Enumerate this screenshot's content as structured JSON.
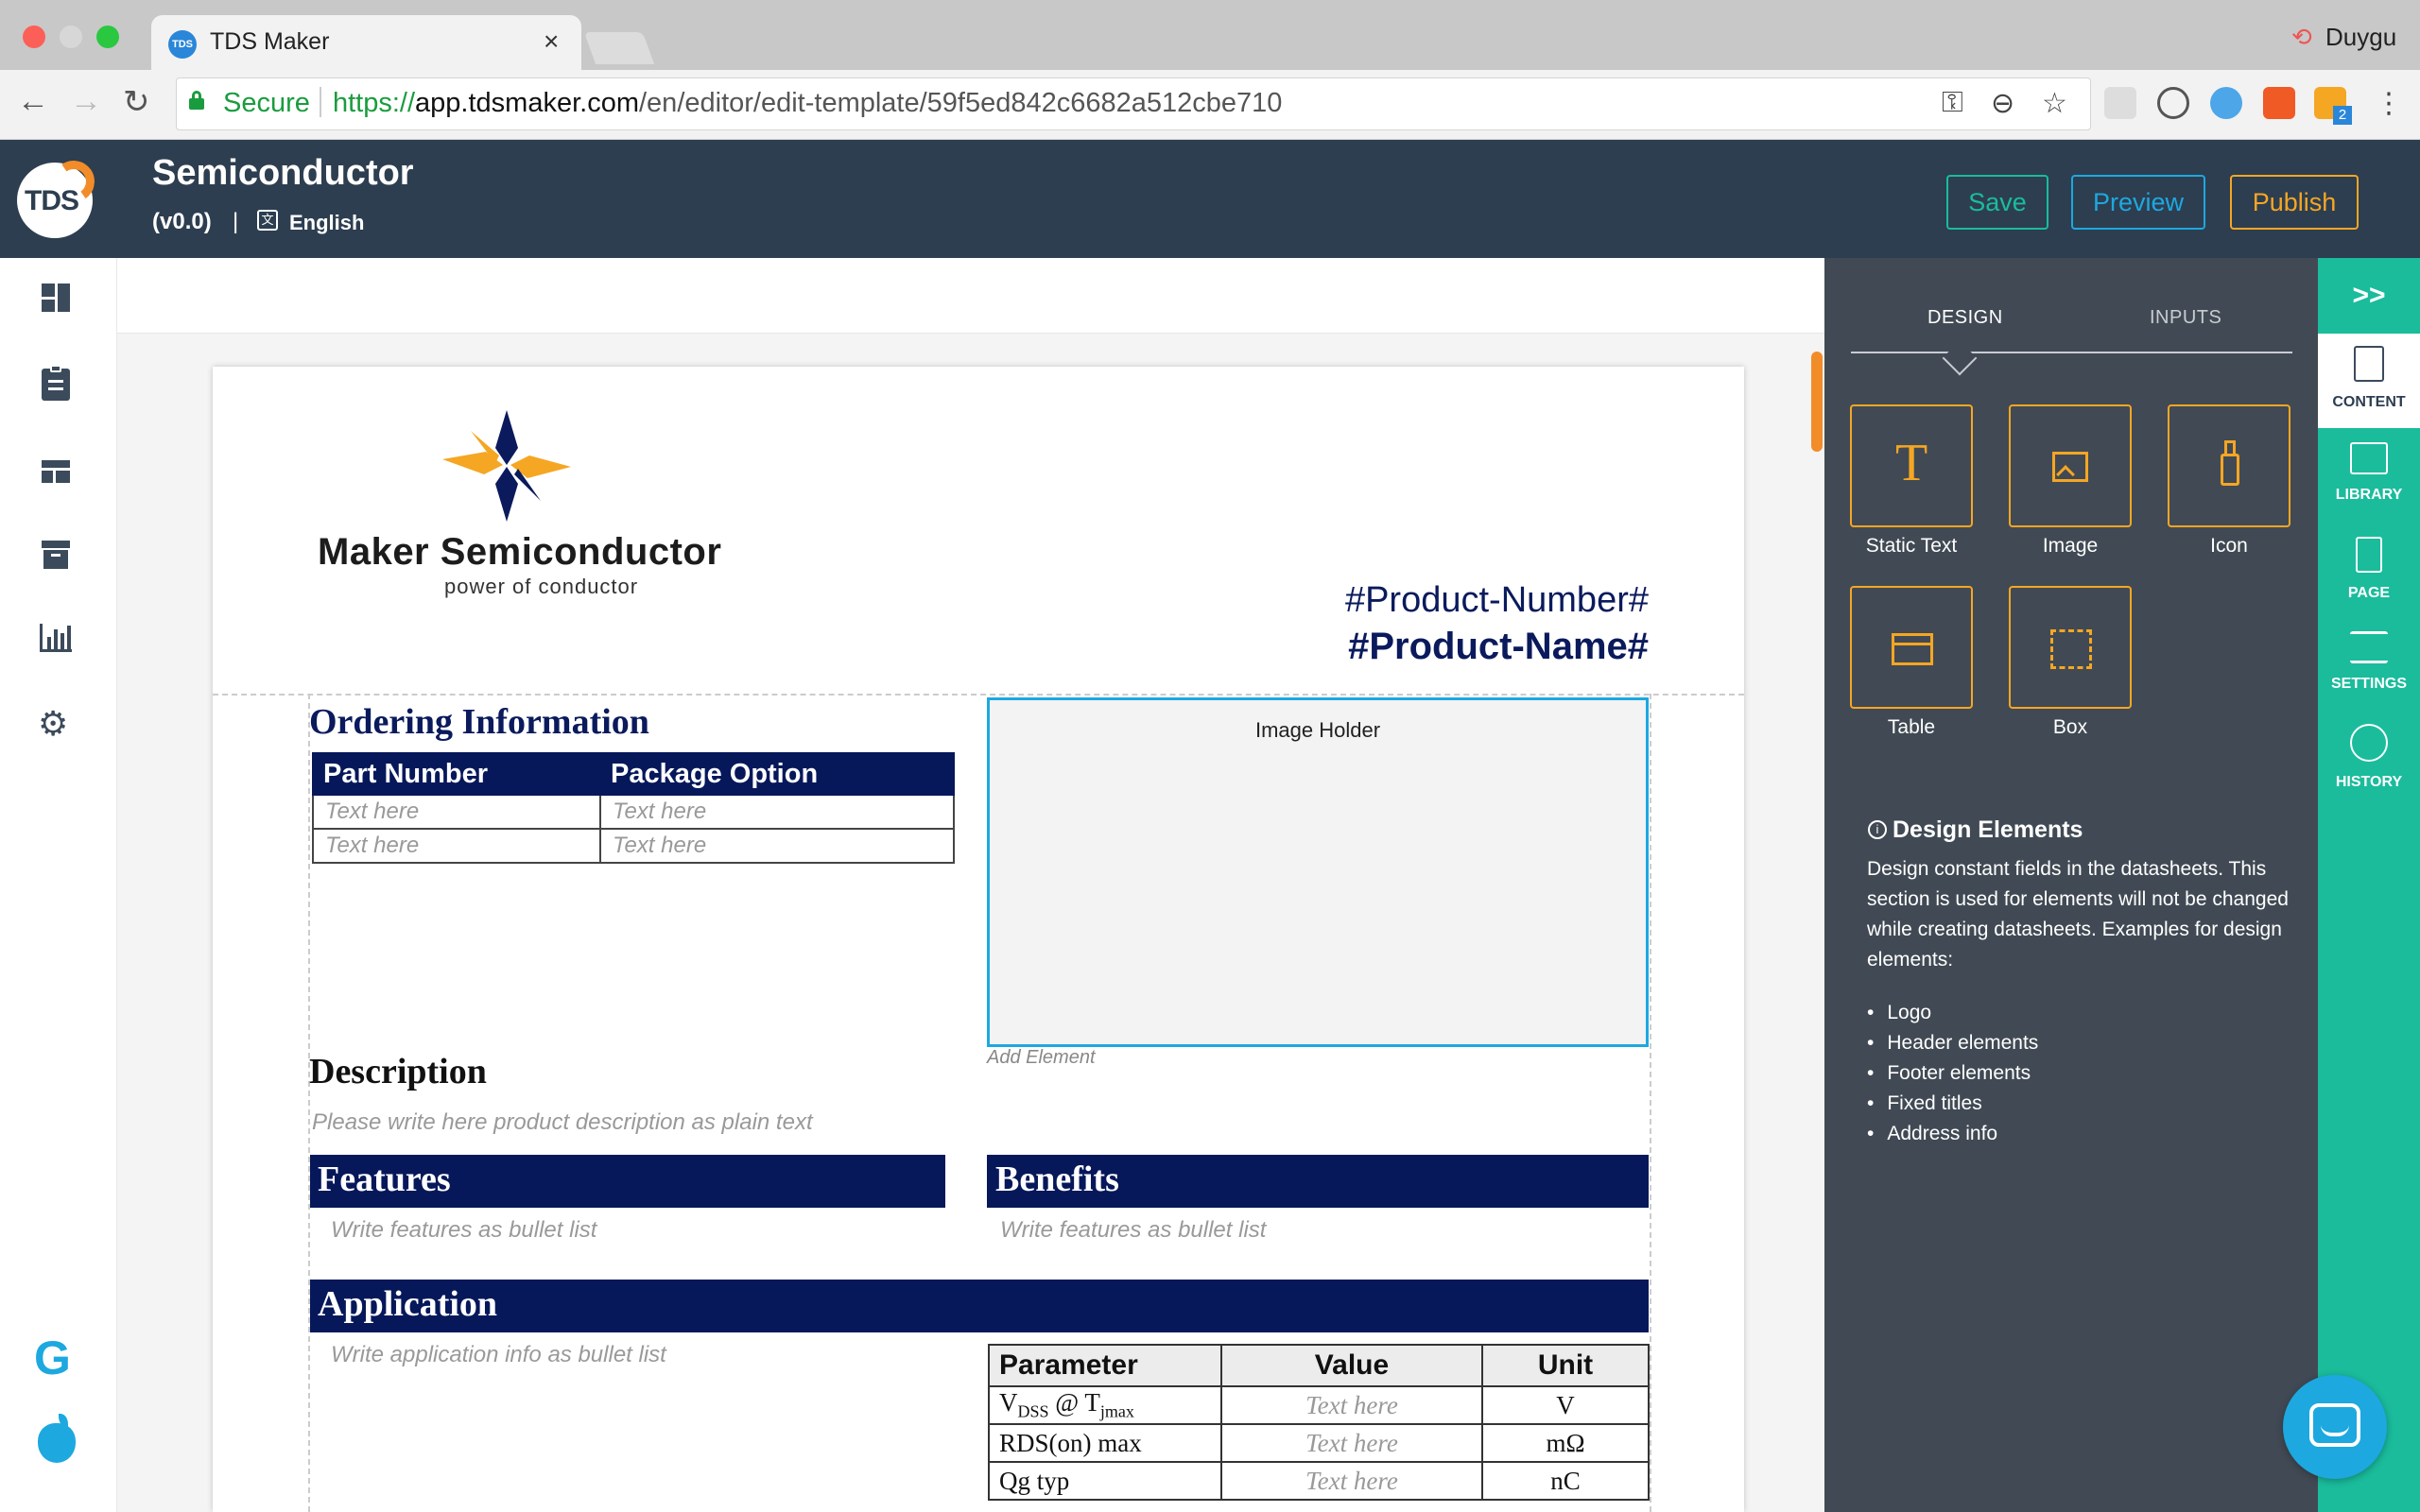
{
  "browser": {
    "tab_title": "TDS Maker",
    "tab_favicon_text": "TDS",
    "tab_close": "×",
    "profile_name": "Duygu",
    "secure_label": "Secure",
    "url_scheme": "https://",
    "url_host": "app.tdsmaker.com",
    "url_path": "/en/editor/edit-template/59f5ed842c6682a512cbe710",
    "back_glyph": "←",
    "forward_glyph": "→",
    "reload_glyph": "↻",
    "extension_badge": "2"
  },
  "app": {
    "logo_text": "TDS",
    "doc_title": "Semiconductor",
    "version": "(v0.0)",
    "separator": "|",
    "language": "English",
    "buttons": {
      "save": "Save",
      "preview": "Preview",
      "publish": "Publish"
    },
    "colors": {
      "header": "#2d3e50",
      "accent_green": "#1abc9c",
      "accent_blue": "#1da8e0",
      "accent_orange": "#f5a623",
      "navy": "#06185a"
    }
  },
  "left_nav": [
    "dashboard-icon",
    "clipboard-icon",
    "layout-icon",
    "archive-icon",
    "bar-chart-icon",
    "gear-icon"
  ],
  "left_nav_bottom": {
    "google": "G",
    "apple": "apple-icon"
  },
  "document": {
    "company_name": "Maker Semiconductor",
    "company_tagline": "power of conductor",
    "product_number": "#Product-Number#",
    "product_name": "#Product-Name#",
    "ordering": {
      "title": "Ordering Information",
      "headers": [
        "Part Number",
        "Package Option"
      ],
      "rows": [
        [
          "Text here",
          "Text here"
        ],
        [
          "Text here",
          "Text here"
        ]
      ]
    },
    "image_holder": "Image Holder",
    "add_element": "Add Element",
    "description": {
      "title": "Description",
      "placeholder": "Please write here product description as plain text"
    },
    "features": {
      "title": "Features",
      "placeholder": "Write features as bullet list"
    },
    "benefits": {
      "title": "Benefits",
      "placeholder": "Write features as bullet list"
    },
    "application": {
      "title": "Application",
      "placeholder": "Write application info as bullet list"
    },
    "parameters": {
      "headers": [
        "Parameter",
        "Value",
        "Unit"
      ],
      "rows": [
        {
          "param": "V",
          "sub1": "DSS",
          "mid": " @ T",
          "sub2": "jmax",
          "value": "Text here",
          "unit": "V"
        },
        {
          "param": "RDS(on) max",
          "value": "Text here",
          "unit": "mΩ"
        },
        {
          "param": "Qg typ",
          "value": "Text here",
          "unit": "nC"
        }
      ]
    }
  },
  "right_panel": {
    "tabs": [
      "DESIGN",
      "INPUTS"
    ],
    "active_tab": "DESIGN",
    "tiles": [
      {
        "label": "Static Text",
        "icon": "text-t-icon"
      },
      {
        "label": "Image",
        "icon": "image-icon"
      },
      {
        "label": "Icon",
        "icon": "spray-icon"
      },
      {
        "label": "Table",
        "icon": "table-icon"
      },
      {
        "label": "Box",
        "icon": "box-icon"
      }
    ],
    "info_title": "Design Elements",
    "info_desc": "Design constant fields in the datasheets. This section is used for elements will not be changed while creating datasheets. Examples for design elements:",
    "examples": [
      "Logo",
      "Header elements",
      "Footer elements",
      "Fixed titles",
      "Address info"
    ]
  },
  "right_iconbar": {
    "collapse": ">>",
    "items": [
      "CONTENT",
      "LIBRARY",
      "PAGE",
      "SETTINGS",
      "HISTORY"
    ],
    "active": "CONTENT"
  }
}
